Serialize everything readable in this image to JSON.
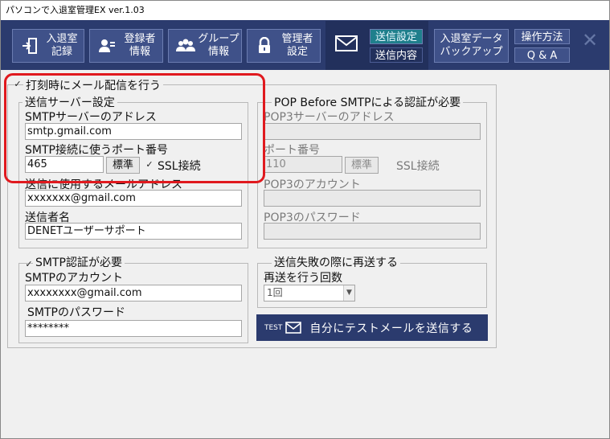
{
  "window": {
    "title": "パソコンで入退室管理EX ver.1.03"
  },
  "toolbar": {
    "buttons": [
      {
        "id": "attendance",
        "line1": "入退室",
        "line2": "記録",
        "icon": "door-enter-icon"
      },
      {
        "id": "registrant",
        "line1": "登録者",
        "line2": "情報",
        "icon": "person-card-icon"
      },
      {
        "id": "group",
        "line1": "グループ",
        "line2": "情報",
        "icon": "people-icon"
      },
      {
        "id": "admin",
        "line1": "管理者",
        "line2": "設定",
        "icon": "lock-icon"
      }
    ],
    "send_settings": "送信設定",
    "send_contents": "送信内容",
    "backup_line1": "入退室データ",
    "backup_line2": "バックアップ",
    "howto": "操作方法",
    "qa": "Q & A"
  },
  "main": {
    "send_on_punch_label": "打刻時にメール配信を行う",
    "send_on_punch_checked": true,
    "smtp_group": {
      "legend": "送信サーバー設定",
      "address_label": "SMTPサーバーのアドレス",
      "address_value": "smtp.gmail.com",
      "port_label": "SMTP接続に使うポート番号",
      "port_value": "465",
      "standard_button": "標準",
      "ssl_label": "SSL接続",
      "ssl_checked": true,
      "from_address_label": "送信に使用するメールアドレス",
      "from_address_value": "xxxxxxx@gmail.com",
      "sender_name_label": "送信者名",
      "sender_name_value": "DENETユーザーサポート"
    },
    "pop_group": {
      "legend": "POP Before SMTPによる認証が必要",
      "enabled_checked": false,
      "address_label": "POP3サーバーのアドレス",
      "address_value": "",
      "port_label": "ポート番号",
      "port_value": "110",
      "standard_button": "標準",
      "ssl_label": "SSL接続",
      "ssl_checked": false,
      "account_label": "POP3のアカウント",
      "account_value": "",
      "password_label": "POP3のパスワード",
      "password_value": ""
    },
    "auth_group": {
      "legend": "SMTP認証が必要",
      "enabled_checked": true,
      "account_label": "SMTPのアカウント",
      "account_value": "xxxxxxxx@gmail.com",
      "password_label": "SMTPのパスワード",
      "password_value": "********"
    },
    "retry_group": {
      "legend": "送信失敗の際に再送する",
      "enabled_checked": false,
      "count_label": "再送を行う回数",
      "count_value": "1回"
    },
    "test_button": {
      "prefix": "TEST",
      "label": "自分にテストメールを送信する"
    }
  },
  "colors": {
    "toolbar_bg": "#2b3b6e",
    "button_bg": "#3f5189",
    "selected_tab": "#1f7f8c",
    "highlight": "#e0191e"
  }
}
